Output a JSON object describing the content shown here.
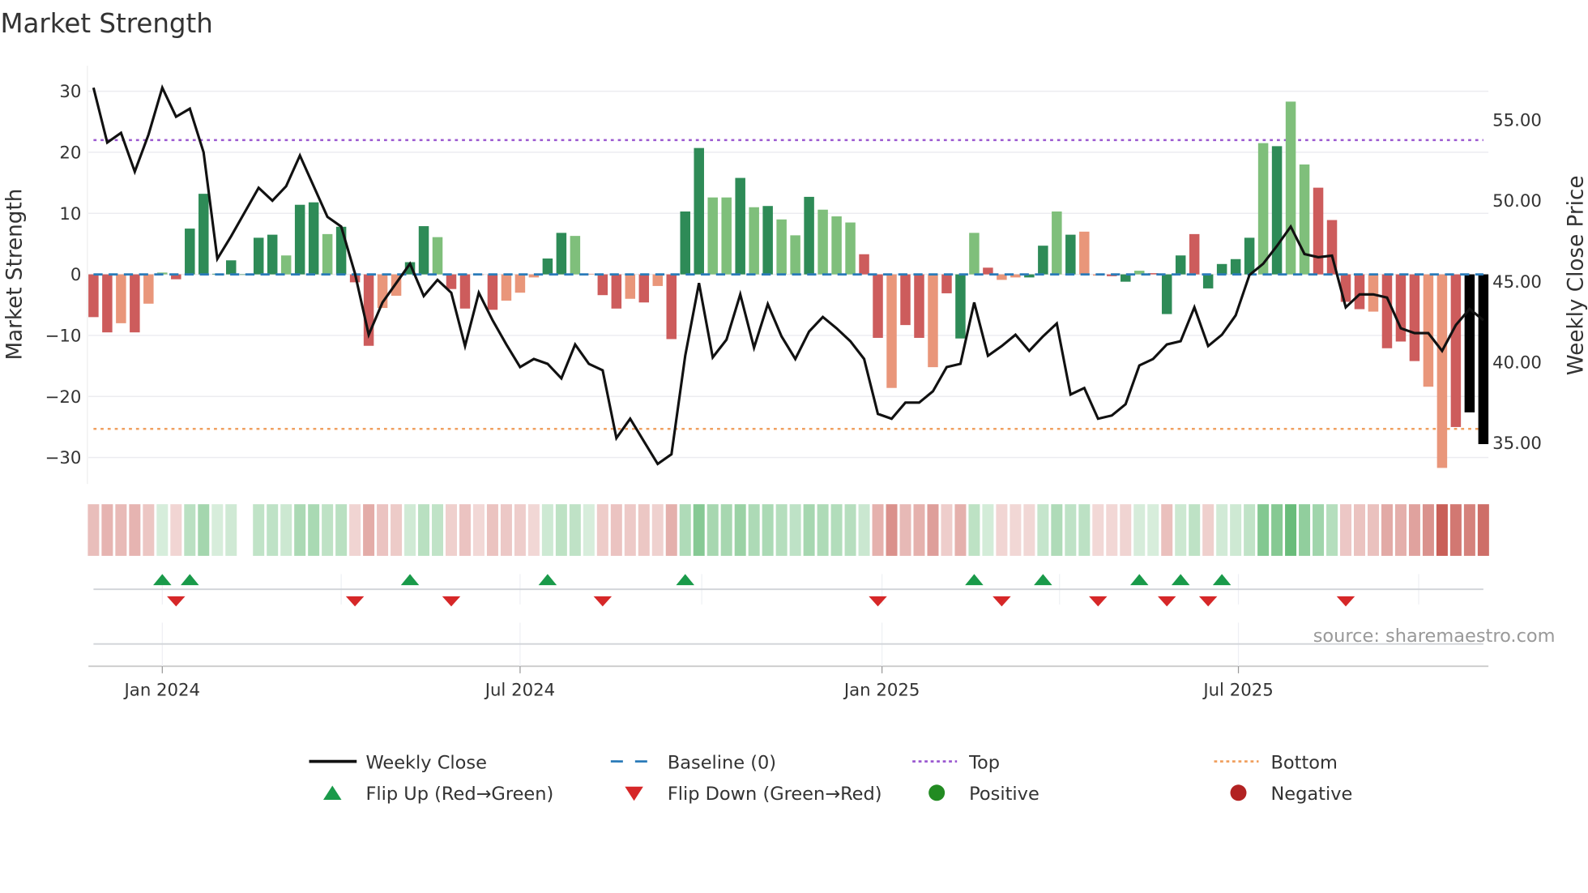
{
  "chart_data": {
    "type": "bar",
    "title": "Market Strength",
    "ylabel": "Market Strength",
    "y2label": "Weekly Close Price",
    "ylim": [
      -35,
      33
    ],
    "y2lim": [
      32.5,
      59
    ],
    "yticks": [
      "30",
      "20",
      "10",
      "0",
      "−10",
      "−20",
      "−30"
    ],
    "ytick_values": [
      30,
      20,
      10,
      0,
      -10,
      -20,
      -30
    ],
    "y2ticks": [
      "55.00",
      "50.00",
      "45.00",
      "40.00",
      "35.00"
    ],
    "y2tick_values": [
      55,
      50,
      45,
      40,
      35
    ],
    "xticks": [
      "Jan 2024",
      "Jul 2024",
      "Jan 2025",
      "Jul 2025"
    ],
    "xtick_week_index": [
      5,
      31,
      57.3,
      83.2
    ],
    "quarter_week_index": [
      5,
      18,
      31,
      44.2,
      57.3,
      70.2,
      83.2,
      96.3
    ],
    "top_level": 22,
    "bottom_level": -25.3,
    "baseline": 0,
    "grid": true,
    "legend_position": "bottom",
    "source": "source: sharemaestro.com",
    "strength": [
      -7,
      -9.5,
      -8,
      -9.5,
      -4.8,
      0.3,
      -0.8,
      7.5,
      13.2,
      0.1,
      2.3,
      0,
      6,
      6.5,
      3.1,
      11.4,
      11.8,
      6.6,
      7.8,
      -1.3,
      -11.7,
      -5.5,
      -3.5,
      2,
      7.9,
      6.1,
      -2.4,
      -5.6,
      -0.1,
      -5.8,
      -4.3,
      -3,
      -0.5,
      2.6,
      6.8,
      6.3,
      0.1,
      -3.4,
      -5.6,
      -4,
      -4.6,
      -1.9,
      -10.6,
      10.3,
      20.7,
      12.6,
      12.6,
      15.8,
      11,
      11.2,
      9,
      6.4,
      12.7,
      10.6,
      9.5,
      8.5,
      3.3,
      -10.4,
      -18.6,
      -8.3,
      -10.4,
      -15.2,
      -3.1,
      -10.5,
      6.8,
      1.1,
      -0.9,
      -0.5,
      -0.5,
      4.7,
      10.3,
      6.5,
      7,
      -0.2,
      -0.3,
      -1.2,
      0.6,
      0.2,
      -6.5,
      3.1,
      6.6,
      -2.3,
      1.7,
      2.5,
      6,
      21.5,
      21,
      28.3,
      18,
      14.2,
      8.9,
      -4.5,
      -5.7,
      -6.1,
      -12.1,
      -11,
      -14.2,
      -18.4,
      -31.7,
      -25,
      -22.6,
      -27.8
    ],
    "shade": "RRrRrgRGGGGGGGgGGgGRRrrGGgRRrRrrrGGgrRRrRrRGGggGgGggGgggRRrRRrRGgRrrGGgGrrRGgRGGRGGGGgGggRRRRrRRRrrR",
    "weekly_close": [
      57.0,
      53.6,
      54.2,
      51.8,
      54.1,
      57.0,
      55.2,
      55.7,
      53.0,
      46.4,
      47.8,
      49.3,
      50.8,
      50.0,
      50.9,
      52.8,
      50.9,
      49.0,
      48.4,
      45.5,
      41.7,
      43.7,
      44.9,
      46.1,
      44.1,
      45.1,
      44.3,
      41.0,
      44.3,
      42.6,
      41.1,
      39.7,
      40.2,
      39.9,
      39.0,
      41.1,
      39.9,
      39.5,
      35.3,
      36.5,
      35.1,
      33.7,
      34.3,
      40.4,
      44.9,
      40.3,
      41.4,
      44.2,
      40.9,
      43.6,
      41.6,
      40.2,
      41.9,
      42.8,
      42.1,
      41.3,
      40.2,
      36.8,
      36.5,
      37.5,
      37.5,
      38.2,
      39.7,
      39.9,
      43.7,
      40.4,
      41.0,
      41.7,
      40.7,
      41.6,
      42.4,
      38.0,
      38.4,
      36.5,
      36.7,
      37.4,
      39.8,
      40.2,
      41.1,
      41.3,
      43.4,
      41.0,
      41.7,
      42.9,
      45.4,
      46.1,
      47.2,
      48.4,
      46.7,
      46.5,
      46.6,
      43.4,
      44.2,
      44.2,
      44.0,
      42.1,
      41.8,
      41.8,
      40.7,
      42.3,
      43.3,
      42.6
    ],
    "flip_up_week_index": [
      5,
      7,
      23,
      33,
      43,
      64,
      69,
      76,
      79,
      82
    ],
    "flip_down_week_index": [
      6,
      19,
      26,
      37,
      57,
      66,
      73,
      78,
      81,
      91
    ],
    "legend": [
      {
        "label": "Weekly Close",
        "symbol": "line"
      },
      {
        "label": "Baseline (0)",
        "symbol": "dash"
      },
      {
        "label": "Top",
        "symbol": "dot-purple"
      },
      {
        "label": "Bottom",
        "symbol": "dot-orange"
      },
      {
        "label": "Flip Up (Red→Green)",
        "symbol": "triangle-up"
      },
      {
        "label": "Flip Down (Green→Red)",
        "symbol": "triangle-down"
      },
      {
        "label": "Positive",
        "symbol": "circle-green"
      },
      {
        "label": "Negative",
        "symbol": "circle-red"
      }
    ],
    "colors": {
      "strong_green": "#2e8b57",
      "light_green": "#7fbf7b",
      "strong_red": "#cd5c5c",
      "light_red": "#e9967a",
      "baseline": "#2b7bb9",
      "top": "#9b59d0",
      "bottom": "#f0a060",
      "price": "#111111",
      "flip_up": "#1a9a4a",
      "flip_down": "#d62728",
      "positive": "#228b22",
      "negative": "#b22222"
    }
  }
}
